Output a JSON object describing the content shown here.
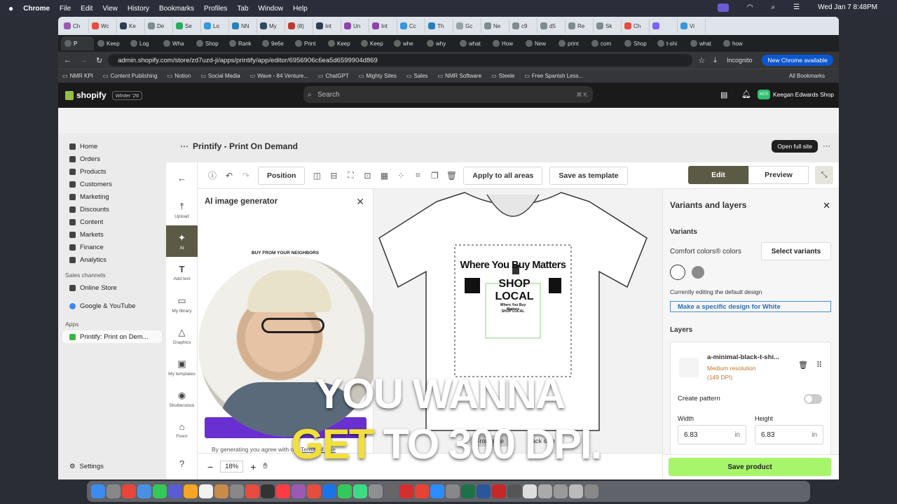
{
  "menubar": {
    "app": "Chrome",
    "items": [
      "File",
      "Edit",
      "View",
      "History",
      "Bookmarks",
      "Profiles",
      "Tab",
      "Window",
      "Help"
    ],
    "datetime": "Wed Jan 7  8:48PM"
  },
  "tabs_row1": [
    "Ch",
    "Wc",
    "Ke",
    "De",
    "Se",
    "Lo",
    "NN",
    "My",
    "(8)",
    "Int",
    "Un",
    "Int",
    "Cc",
    "Th",
    "Gc",
    "Ne",
    "c9",
    "d5",
    "Re",
    "Sk",
    "Ch",
    "",
    "Vi"
  ],
  "tabs_row2": [
    {
      "label": "P",
      "active": true
    },
    {
      "label": "Keep",
      "active": false
    },
    {
      "label": "Log",
      "active": false
    },
    {
      "label": "Wha",
      "active": false
    },
    {
      "label": "Shop",
      "active": false
    },
    {
      "label": "Rank",
      "active": false
    },
    {
      "label": "9e6e",
      "active": false
    },
    {
      "label": "Print",
      "active": false
    },
    {
      "label": "Keep",
      "active": false
    },
    {
      "label": "Keep",
      "active": false
    },
    {
      "label": "whe",
      "active": false
    },
    {
      "label": "why",
      "active": false
    },
    {
      "label": "what",
      "active": false
    },
    {
      "label": "How",
      "active": false
    },
    {
      "label": "New",
      "active": false
    },
    {
      "label": "print",
      "active": false
    },
    {
      "label": "com",
      "active": false
    },
    {
      "label": "Shop",
      "active": false
    },
    {
      "label": "t-shi",
      "active": false
    },
    {
      "label": "what",
      "active": false
    },
    {
      "label": "how",
      "active": false
    }
  ],
  "address": {
    "url": "admin.shopify.com/store/zd7uzd-ji/apps/printify/app/editor/6956906c6ea5d6599904d869",
    "incognito": "Incognito",
    "new_chrome": "New Chrome available"
  },
  "bookmarks": [
    "NMR KPI",
    "Content Publishing",
    "Notion",
    "Social Media",
    "Wave - 84 Venture...",
    "ChatGPT",
    "Mighty Sites",
    "Sales",
    "NMR Software",
    "Steele",
    "Free Spanish Less..."
  ],
  "all_bookmarks": "All Bookmarks",
  "shopify": {
    "logo": "shopify",
    "edition": "Winter '26",
    "search_placeholder": "Search",
    "shortcut": "⌘ K",
    "store_initials": "KES",
    "store_name": "Keegan Edwards Shop"
  },
  "nav": {
    "items": [
      "Home",
      "Orders",
      "Products",
      "Customers",
      "Marketing",
      "Discounts",
      "Content",
      "Markets",
      "Finance",
      "Analytics"
    ],
    "sales_channels": "Sales channels",
    "online_store": "Online Store",
    "google": "Google & YouTube",
    "apps": "Apps",
    "printify": "Printify: Print on Dem...",
    "settings": "Settings"
  },
  "page": {
    "title": "Printify - Print On Demand",
    "open_full_site": "Open full site"
  },
  "toolbar": {
    "position": "Position",
    "apply_all": "Apply to all areas",
    "save_template": "Save as template",
    "edit": "Edit",
    "preview": "Preview"
  },
  "sidetools": [
    "Upload",
    "AI",
    "Add text",
    "My library",
    "Graphics",
    "My templates",
    "Shutterstock",
    "Fiverr"
  ],
  "ai_panel": {
    "title": "AI image generator",
    "thumb_text": "BUY FROM YOUR NEIGHBORS",
    "terms_prefix": "By generating you agree with our",
    "terms_link": "Terms of Use"
  },
  "canvas": {
    "design_line1": "Where You Buy Matters",
    "design_line2": "SHOP LOCAL",
    "mini_line1": "Where You Buy Matters",
    "mini_line2": "SHOP LOCAL",
    "front_side": "Front side",
    "back_side": "Back side",
    "zoom": "18%"
  },
  "right_panel": {
    "title": "Variants and layers",
    "variants_heading": "Variants",
    "comfort_colors": "Comfort colors® colors",
    "select_variants": "Select variants",
    "swatches": [
      "#ffffff",
      "#8a8a8a"
    ],
    "editing_default": "Currently editing the default design",
    "specific_design": "Make a specific design for White",
    "layers_heading": "Layers",
    "layer_name": "a-minimal-black-t-shi...",
    "resolution": "Medium resolution",
    "dpi": "(149 DPI)",
    "create_pattern": "Create pattern",
    "width_label": "Width",
    "height_label": "Height",
    "width_value": "6.83",
    "height_value": "6.83",
    "unit": "in",
    "save_product": "Save product"
  },
  "caption": {
    "line1": "YOU WANNA",
    "line2_highlight": "GET",
    "line2_rest": "TO 300 DPI."
  },
  "colors": {
    "shopify_bar": "#1a1a1a",
    "edit_active": "#5b5b45",
    "save_green": "#a6f56b",
    "resolution_orange": "#c0762b",
    "link_blue": "#2a6fb5",
    "caption_yellow": "#f2e03a"
  }
}
